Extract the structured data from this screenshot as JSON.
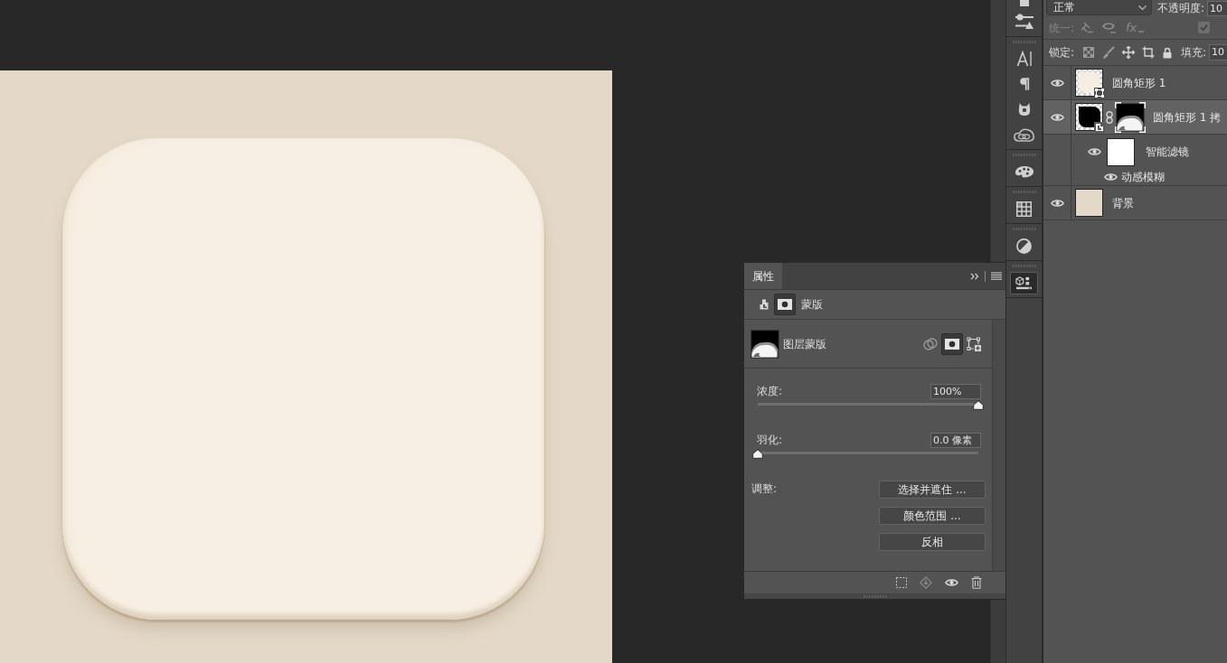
{
  "layers_panel": {
    "blend_mode": "正常",
    "opacity_label": "不透明度:",
    "opacity_value": "10",
    "unify_label": "统一:",
    "unify_fx": "fx",
    "propagate_checkbox": {
      "checked": true
    },
    "lock_label": "锁定:",
    "fill_label": "填充:",
    "fill_value": "10"
  },
  "layers": [
    {
      "kind": "shape",
      "name": "圆角矩形 1",
      "visible": true,
      "selected": false
    },
    {
      "kind": "smart",
      "name": "圆角矩形 1 拷",
      "visible": true,
      "selected": true,
      "children": [
        {
          "kind": "filter_group",
          "name": "智能滤镜",
          "visible": true,
          "children": [
            {
              "kind": "filter",
              "name": "动感模糊",
              "visible": true
            }
          ]
        }
      ]
    },
    {
      "kind": "background",
      "name": "背景",
      "visible": true,
      "selected": false
    }
  ],
  "dock_groups": [
    {
      "icons": [
        {
          "kind": "partial",
          "selected": false
        },
        {
          "kind": "sliders",
          "selected": false
        }
      ]
    },
    {
      "icons": [
        {
          "kind": "character",
          "selected": false
        },
        {
          "kind": "paragraph",
          "selected": false
        },
        {
          "kind": "libraries",
          "selected": false
        },
        {
          "kind": "cloud",
          "selected": false
        }
      ]
    },
    {
      "icons": [
        {
          "kind": "palette",
          "selected": false
        }
      ]
    },
    {
      "icons": [
        {
          "kind": "grid",
          "selected": false
        }
      ]
    },
    {
      "icons": [
        {
          "kind": "contrast",
          "selected": false
        }
      ]
    },
    {
      "icons": [
        {
          "kind": "cube",
          "selected": true
        }
      ]
    }
  ],
  "properties_panel": {
    "tabs": [
      {
        "label": "属性",
        "selected": true
      }
    ],
    "header_modes": [
      {
        "kind": "smart_object",
        "selected": false
      },
      {
        "kind": "mask",
        "selected": true
      }
    ],
    "section_title": "蒙版",
    "mask_label": "图层蒙版",
    "mask_modes": [
      {
        "kind": "intersect",
        "selected": false
      },
      {
        "kind": "pixel",
        "selected": true
      },
      {
        "kind": "vector",
        "selected": false
      }
    ],
    "sliders": [
      {
        "label": "浓度:",
        "value": "100%",
        "level": 1
      },
      {
        "label": "羽化:",
        "value": "0.0 像素",
        "level": 0
      }
    ],
    "adjust_label": "调整:",
    "buttons": [
      "选择并遮住 ...",
      "颜色范围 ...",
      "反相"
    ]
  }
}
